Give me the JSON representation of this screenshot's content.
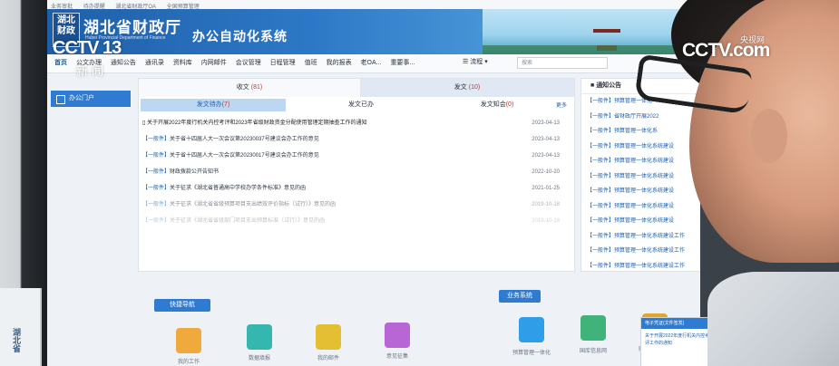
{
  "browser_tabs": [
    "业务审批",
    "待办提醒",
    "湖北省财政厅OA",
    "全国预算管理"
  ],
  "header": {
    "logo_text": "湖北财政",
    "org_name": "湖北省财政厅",
    "org_name_en": "Hubei Provincial Department of Finance",
    "system_name": "办公自动化系统"
  },
  "nav": {
    "items": [
      "首页",
      "公文办理",
      "通知公告",
      "通讯录",
      "资料库",
      "内网邮件",
      "会议管理",
      "日程管理",
      "值班",
      "我的报表",
      "老OA...",
      "重要事..."
    ],
    "flow_label": "流程",
    "search_placeholder": "搜索"
  },
  "sidebar": {
    "portal_label": "办公门户"
  },
  "main": {
    "tab_in": {
      "label": "收文",
      "count": "(81)"
    },
    "tab_out": {
      "label": "发文",
      "count": "(10)"
    },
    "subtabs": [
      {
        "label": "发文待办",
        "count": "(7)"
      },
      {
        "label": "发文已办",
        "count": ""
      },
      {
        "label": "发文知会",
        "count": "(0)"
      }
    ],
    "more_label": "更多",
    "rows": [
      {
        "tag": "",
        "title": "关于开展2022年度行机关内控考评和2023年省级财政资金分配使用管理定期抽查工作的通知",
        "date": "2023-04-13"
      },
      {
        "tag": "【一般件】",
        "title": "关于省十四届人大一次会议第20230037号建议会办工作的意见",
        "date": "2023-04-13"
      },
      {
        "tag": "【一般件】",
        "title": "关于省十四届人大一次会议第20230017号建议会办工作的意见",
        "date": "2023-04-13"
      },
      {
        "tag": "【一般件】",
        "title": "财政拨款公开告知书",
        "date": "2022-10-20"
      },
      {
        "tag": "【一般件】",
        "title": "关于征求《湖北省普通高中学校办学条件标准》意见的函",
        "date": "2021-01-25"
      },
      {
        "tag": "【一般件】",
        "title": "关于征求《湖北省省级预算项目支出绩效评价指标（试行）》意见的函",
        "date": "2019-10-18"
      },
      {
        "tag": "【一般件】",
        "title": "关于征求《湖北省省级部门项目支出预算标准（试行）》意见的函",
        "date": "2019-10-18"
      }
    ]
  },
  "notice": {
    "title": "通知公告",
    "items": [
      "【一般件】预算管理一体化",
      "【一般件】省财政厅开展2022",
      "【一般件】预算管理一体化系",
      "【一般件】预算管理一体化系统建设",
      "【一般件】预算管理一体化系统建设",
      "【一般件】预算管理一体化系统建设",
      "【一般件】预算管理一体化系统建设",
      "【一般件】预算管理一体化系统建设",
      "【一般件】预算管理一体化系统建设",
      "【一般件】预算管理一体化系统建设工作",
      "【一般件】预算管理一体化系统建设工作",
      "【一般件】预算管理一体化系统建设工作"
    ]
  },
  "quick_nav": {
    "label": "快捷导航",
    "items": [
      "我的工作",
      "数据填报",
      "我的邮件",
      "意见征集"
    ]
  },
  "business": {
    "label": "业务系统",
    "items": [
      "预算管理一体化",
      "国库信息网",
      "财政监督系统"
    ]
  },
  "float_panel": {
    "title": "电子凭证(文件签发)",
    "text": "关于开展2022年度行机关内控考评工作的通知"
  },
  "watermark": {
    "cctv": "CCTV 13",
    "news": "新闻",
    "right_top": "央视网",
    "right": "CCTV.com"
  },
  "left_book": "湖北省",
  "colors": {
    "brand_blue": "#1f5fa8",
    "accent_blue": "#2e7bd1",
    "count_red": "#c23a2e",
    "icon_colors": [
      "#f0a93b",
      "#35b7b0",
      "#e4bf33",
      "#b866d6",
      "#2e9ee8",
      "#3fb37a",
      "#e2a728"
    ]
  }
}
